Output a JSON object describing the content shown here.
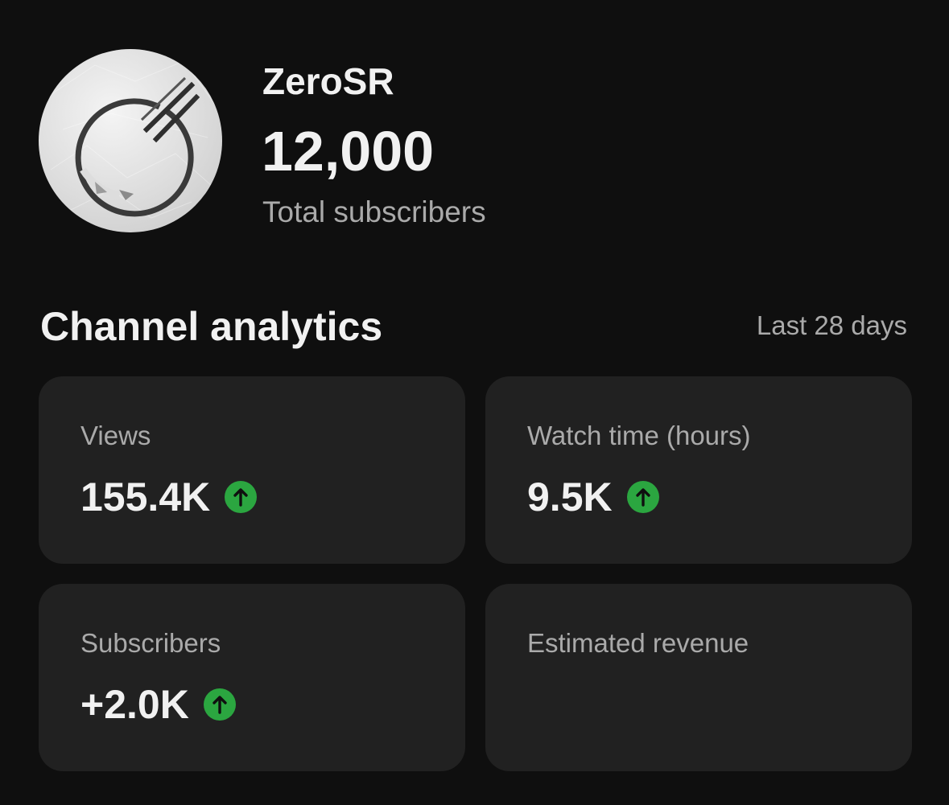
{
  "channel": {
    "name": "ZeroSR",
    "subscriber_total": "12,000",
    "subscriber_caption": "Total subscribers",
    "avatar_icon": "channel-logo-ring-icon"
  },
  "analytics": {
    "title": "Channel analytics",
    "date_range": "Last 28 days",
    "accent_up_color": "#2ba640",
    "cards": [
      {
        "label": "Views",
        "value": "155.4K",
        "trend": "up",
        "trend_icon": "arrow-up-icon"
      },
      {
        "label": "Watch time (hours)",
        "value": "9.5K",
        "trend": "up",
        "trend_icon": "arrow-up-icon"
      },
      {
        "label": "Subscribers",
        "value": "+2.0K",
        "trend": "up",
        "trend_icon": "arrow-up-icon"
      },
      {
        "label": "Estimated revenue",
        "value": "",
        "trend": "",
        "trend_icon": ""
      }
    ]
  }
}
